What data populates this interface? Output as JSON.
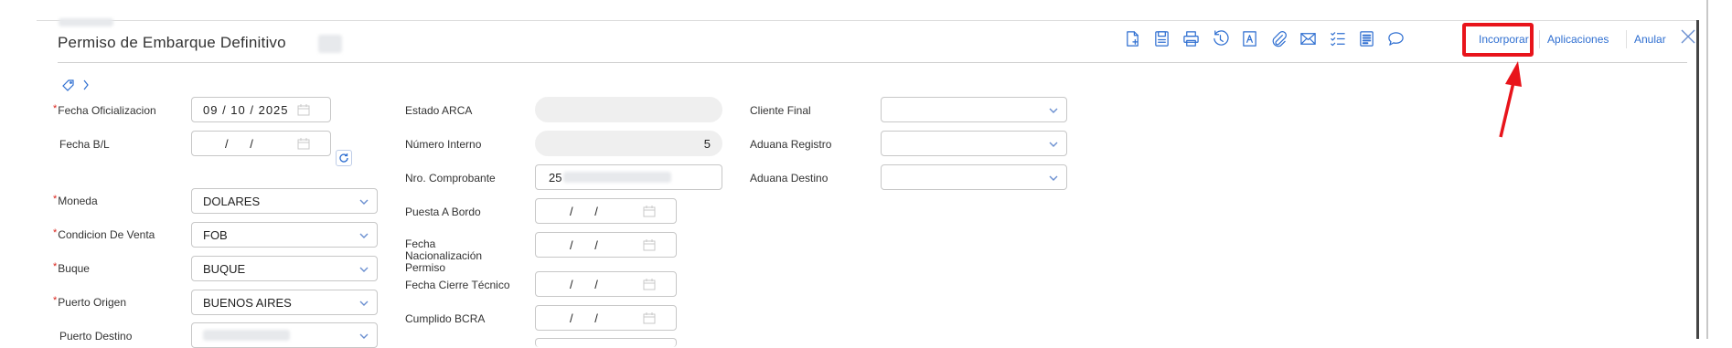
{
  "header": {
    "breadcrumb_label": "",
    "title": "Permiso de Embarque Definitivo"
  },
  "toolbar": {
    "icons": [
      "new-document-icon",
      "save-icon",
      "print-icon",
      "history-icon",
      "text-document-icon",
      "attachment-icon",
      "email-icon",
      "checklist-icon",
      "notes-icon",
      "comment-icon"
    ],
    "incorporar_label": "Incorporar",
    "aplicaciones_label": "Aplicaciones",
    "anular_label": "Anular",
    "highlight_color": "#e8141b"
  },
  "form": {
    "col1": {
      "fecha_oficializacion": {
        "label": "Fecha Oficializacion",
        "value": "09 / 10 / 2025",
        "required": true
      },
      "fecha_bl": {
        "label": "Fecha B/L",
        "value": "/ /",
        "required": false
      },
      "moneda": {
        "label": "Moneda",
        "value": "DOLARES",
        "required": true
      },
      "condicion_venta": {
        "label": "Condicion De Venta",
        "value": "FOB",
        "required": true
      },
      "buque": {
        "label": "Buque",
        "value": "BUQUE",
        "required": true
      },
      "puerto_origen": {
        "label": "Puerto Origen",
        "value": "BUENOS AIRES",
        "required": true
      },
      "puerto_destino": {
        "label": "Puerto Destino",
        "value": "",
        "required": false
      }
    },
    "col2": {
      "estado_arca": {
        "label": "Estado ARCA",
        "value": ""
      },
      "numero_interno": {
        "label": "Número Interno",
        "value": "5"
      },
      "nro_comprobante": {
        "label": "Nro. Comprobante",
        "value": "25"
      },
      "puesta_a_bordo": {
        "label": "Puesta A Bordo",
        "value": "/ /"
      },
      "fecha_nacionalizacion": {
        "label": "Fecha Nacionalización Permiso",
        "value": "/ /"
      },
      "fecha_cierre": {
        "label": "Fecha Cierre Técnico",
        "value": "/ /"
      },
      "cumplido_bcra": {
        "label": "Cumplido BCRA",
        "value": "/ /"
      }
    },
    "col3": {
      "cliente_final": {
        "label": "Cliente Final",
        "value": ""
      },
      "aduana_registro": {
        "label": "Aduana Registro",
        "value": ""
      },
      "aduana_destino": {
        "label": "Aduana Destino",
        "value": ""
      }
    }
  },
  "required_marker": "*"
}
